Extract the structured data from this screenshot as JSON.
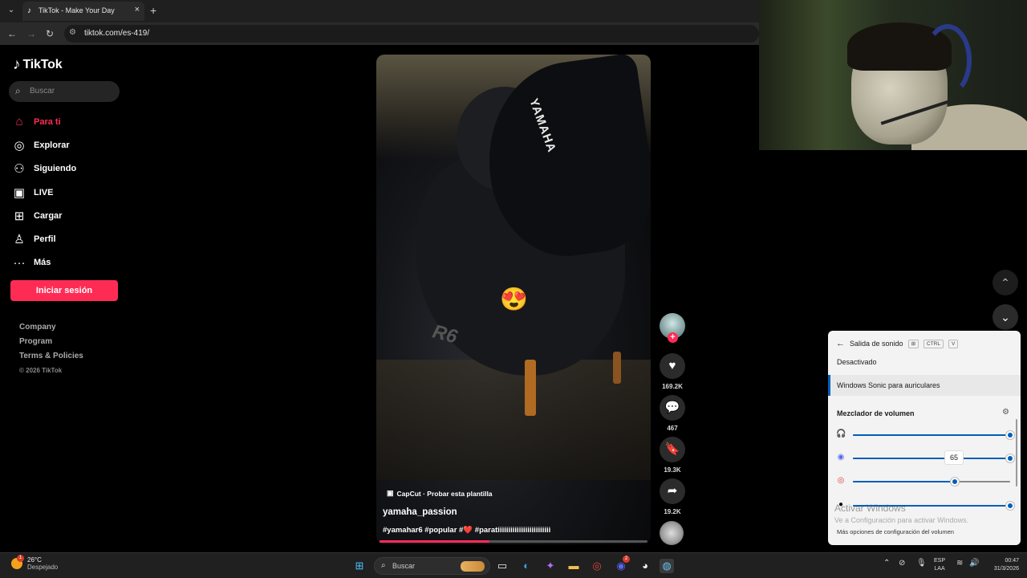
{
  "browser": {
    "tab_title": "TikTok - Make Your Day",
    "url": "tiktok.com/es-419/"
  },
  "tiktok": {
    "logo_text": "TikTok",
    "search_placeholder": "Buscar",
    "nav": [
      {
        "label": "Para ti",
        "icon": "home-icon",
        "active": true
      },
      {
        "label": "Explorar",
        "icon": "compass-icon"
      },
      {
        "label": "Siguiendo",
        "icon": "following-icon"
      },
      {
        "label": "LIVE",
        "icon": "live-icon"
      },
      {
        "label": "Cargar",
        "icon": "upload-icon"
      },
      {
        "label": "Perfil",
        "icon": "profile-icon"
      },
      {
        "label": "Más",
        "icon": "more-icon"
      }
    ],
    "login_label": "Iniciar sesión",
    "footer_links": [
      "Company",
      "Program",
      "Terms & Policies"
    ],
    "copyright": "© 2026 TikTok"
  },
  "video": {
    "overlay_text": "YAMAHA",
    "model_text": "R6",
    "capcut_label": "CapCut · Probar esta plantilla",
    "author": "yamaha_passion",
    "caption": "#yamahar6 #popular #❤️ #paratiiiiiiiiiiiiiiiiiiiiiiiii",
    "progress": 0.41,
    "likes": "169.2K",
    "comments": "467",
    "saves": "19.3K",
    "shares": "19.2K"
  },
  "volume_panel": {
    "title": "Salida de sonido",
    "shortcut_keys": [
      "⊞",
      "CTRL",
      "V"
    ],
    "options": [
      "Desactivado",
      "Windows Sonic para auriculares"
    ],
    "selected_option": 1,
    "mixer_title": "Mezclador de volumen",
    "rows": [
      {
        "icon": "headphones-icon",
        "value": 100
      },
      {
        "icon": "discord-icon",
        "value": 100
      },
      {
        "icon": "chrome-icon",
        "value": 65
      },
      {
        "icon": "steam-icon",
        "value": 100
      }
    ],
    "tooltip_value": "65",
    "activation_title": "Activar Windows",
    "activation_sub": "Ve a Configuración para activar Windows.",
    "more_settings": "Más opciones de configuración del volumen"
  },
  "taskbar": {
    "temperature": "26°C",
    "weather": "Despejado",
    "weather_badge": "1",
    "search_placeholder": "Buscar",
    "discord_badge": "2",
    "lang_top": "ESP",
    "lang_bottom": "LAA",
    "time": "00:47",
    "date": "31/3/2026"
  },
  "colors": {
    "accent": "#fe2c55",
    "win_blue": "#005fb8"
  }
}
